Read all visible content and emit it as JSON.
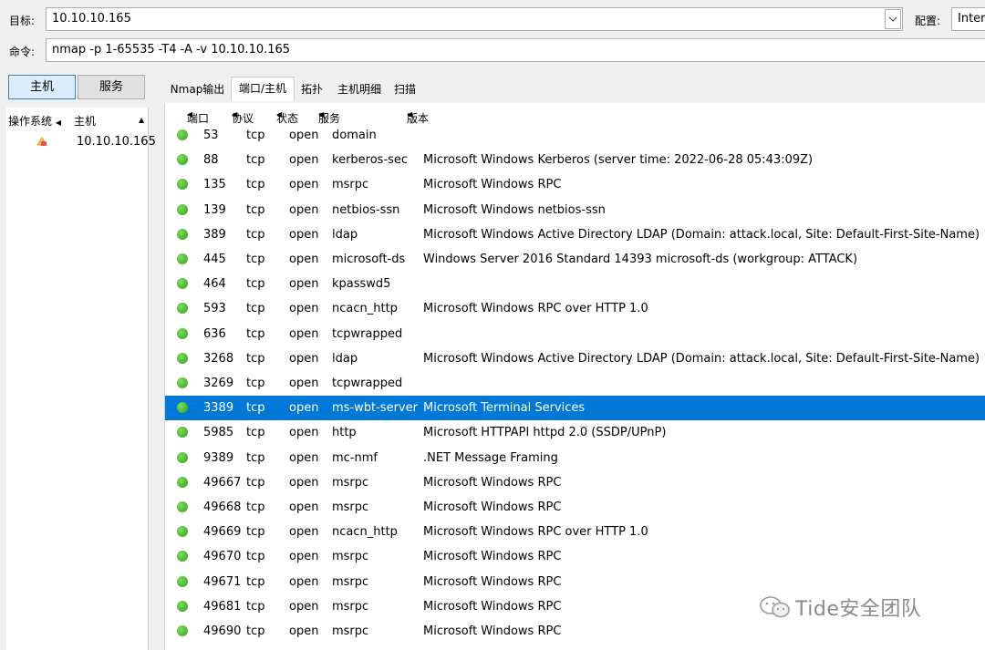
{
  "toolbar": {
    "target_label": "目标:",
    "target_value": "10.10.10.165",
    "profile_label": "配置:",
    "profile_value": "Inter",
    "command_label": "命令:",
    "command_value": "nmap -p 1-65535 -T4 -A -v 10.10.10.165"
  },
  "left": {
    "hosts_button": "主机",
    "services_button": "服务",
    "col_os": "操作系统",
    "col_host": "主机",
    "host_ip": "10.10.10.165"
  },
  "tabs": [
    "Nmap输出",
    "端口/主机",
    "拓扑",
    "主机明细",
    "扫描"
  ],
  "table": {
    "headers": [
      "端口",
      "协议",
      "状态",
      "服务",
      "版本"
    ],
    "rows": [
      {
        "port": "53",
        "proto": "tcp",
        "state": "open",
        "service": "domain",
        "version": ""
      },
      {
        "port": "88",
        "proto": "tcp",
        "state": "open",
        "service": "kerberos-sec",
        "version": "Microsoft Windows Kerberos (server time: 2022-06-28 05:43:09Z)"
      },
      {
        "port": "135",
        "proto": "tcp",
        "state": "open",
        "service": "msrpc",
        "version": "Microsoft Windows RPC"
      },
      {
        "port": "139",
        "proto": "tcp",
        "state": "open",
        "service": "netbios-ssn",
        "version": "Microsoft Windows netbios-ssn"
      },
      {
        "port": "389",
        "proto": "tcp",
        "state": "open",
        "service": "ldap",
        "version": "Microsoft Windows Active Directory LDAP (Domain: attack.local, Site: Default-First-Site-Name)"
      },
      {
        "port": "445",
        "proto": "tcp",
        "state": "open",
        "service": "microsoft-ds",
        "version": "Windows Server 2016 Standard 14393 microsoft-ds (workgroup: ATTACK)"
      },
      {
        "port": "464",
        "proto": "tcp",
        "state": "open",
        "service": "kpasswd5",
        "version": ""
      },
      {
        "port": "593",
        "proto": "tcp",
        "state": "open",
        "service": "ncacn_http",
        "version": "Microsoft Windows RPC over HTTP 1.0"
      },
      {
        "port": "636",
        "proto": "tcp",
        "state": "open",
        "service": "tcpwrapped",
        "version": ""
      },
      {
        "port": "3268",
        "proto": "tcp",
        "state": "open",
        "service": "ldap",
        "version": "Microsoft Windows Active Directory LDAP (Domain: attack.local, Site: Default-First-Site-Name)"
      },
      {
        "port": "3269",
        "proto": "tcp",
        "state": "open",
        "service": "tcpwrapped",
        "version": ""
      },
      {
        "port": "3389",
        "proto": "tcp",
        "state": "open",
        "service": "ms-wbt-server",
        "version": "Microsoft Terminal Services",
        "selected": true
      },
      {
        "port": "5985",
        "proto": "tcp",
        "state": "open",
        "service": "http",
        "version": "Microsoft HTTPAPI httpd 2.0 (SSDP/UPnP)"
      },
      {
        "port": "9389",
        "proto": "tcp",
        "state": "open",
        "service": "mc-nmf",
        "version": ".NET Message Framing"
      },
      {
        "port": "49667",
        "proto": "tcp",
        "state": "open",
        "service": "msrpc",
        "version": "Microsoft Windows RPC"
      },
      {
        "port": "49668",
        "proto": "tcp",
        "state": "open",
        "service": "msrpc",
        "version": "Microsoft Windows RPC"
      },
      {
        "port": "49669",
        "proto": "tcp",
        "state": "open",
        "service": "ncacn_http",
        "version": "Microsoft Windows RPC over HTTP 1.0"
      },
      {
        "port": "49670",
        "proto": "tcp",
        "state": "open",
        "service": "msrpc",
        "version": "Microsoft Windows RPC"
      },
      {
        "port": "49671",
        "proto": "tcp",
        "state": "open",
        "service": "msrpc",
        "version": "Microsoft Windows RPC"
      },
      {
        "port": "49681",
        "proto": "tcp",
        "state": "open",
        "service": "msrpc",
        "version": "Microsoft Windows RPC"
      },
      {
        "port": "49690",
        "proto": "tcp",
        "state": "open",
        "service": "msrpc",
        "version": "Microsoft Windows RPC"
      }
    ]
  },
  "watermark": "Tide安全团队",
  "colors": {
    "selection": "#0078d7",
    "status_open": "#3bb02a"
  }
}
